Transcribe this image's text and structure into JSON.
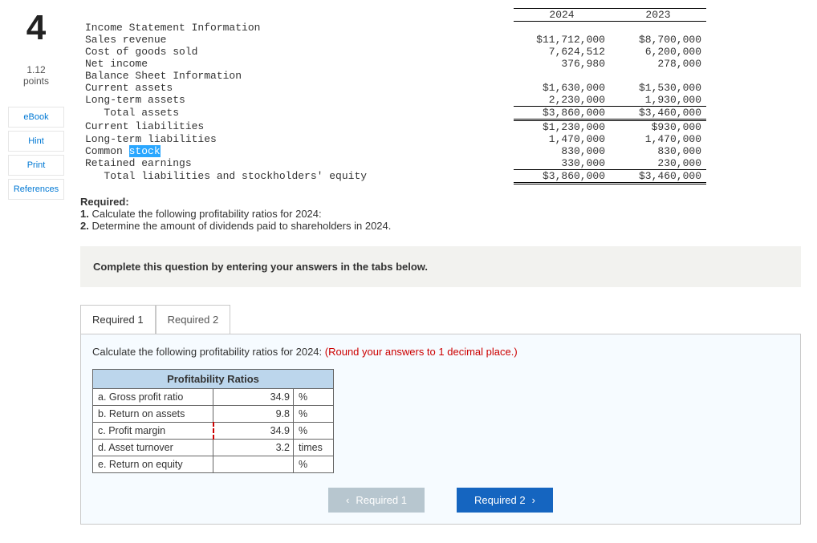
{
  "question_number": "4",
  "points": {
    "value": "1.12",
    "label": "points"
  },
  "side_buttons": [
    "eBook",
    "Hint",
    "Print",
    "References"
  ],
  "fin": {
    "col_years": [
      "2024",
      "2023"
    ],
    "rows": [
      {
        "label": "Income Statement Information",
        "type": "section"
      },
      {
        "label": "Sales revenue",
        "v24": "$11,712,000",
        "v23": "$8,700,000"
      },
      {
        "label": "Cost of goods sold",
        "v24": "7,624,512",
        "v23": "6,200,000"
      },
      {
        "label": "Net income",
        "v24": "376,980",
        "v23": "278,000"
      },
      {
        "label": "Balance Sheet Information",
        "type": "section"
      },
      {
        "label": "Current assets",
        "v24": "$1,630,000",
        "v23": "$1,530,000"
      },
      {
        "label": "Long-term assets",
        "v24": "2,230,000",
        "v23": "1,930,000"
      },
      {
        "label": "   Total assets",
        "v24": "$3,860,000",
        "v23": "$3,460,000",
        "type": "grandtotal"
      },
      {
        "label": "Current liabilities",
        "v24": "$1,230,000",
        "v23": "$930,000"
      },
      {
        "label": "Long-term liabilities",
        "v24": "1,470,000",
        "v23": "1,470,000"
      },
      {
        "label_html": true,
        "label_pre": "Common ",
        "label_hi": "stock",
        "v24": "830,000",
        "v23": "830,000"
      },
      {
        "label": "Retained earnings",
        "v24": "330,000",
        "v23": "230,000"
      },
      {
        "label": "   Total liabilities and stockholders' equity",
        "v24": "$3,860,000",
        "v23": "$3,460,000",
        "type": "grandtotal"
      }
    ]
  },
  "required": {
    "heading": "Required:",
    "items": [
      "Calculate the following profitability ratios for 2024:",
      "Determine the amount of dividends paid to shareholders in 2024."
    ]
  },
  "instruction_bar": "Complete this question by entering your answers in the tabs below.",
  "tabs": [
    {
      "label": "Required 1",
      "active": true
    },
    {
      "label": "Required 2",
      "active": false
    }
  ],
  "tab_prompt": {
    "text": "Calculate the following profitability ratios for 2024: ",
    "note": "(Round your answers to 1 decimal place.)"
  },
  "ratio_table": {
    "header": "Profitability Ratios",
    "rows": [
      {
        "label": "a. Gross profit ratio",
        "value": "34.9",
        "unit": "%",
        "dashed": "none"
      },
      {
        "label": "b. Return on assets",
        "value": "9.8",
        "unit": "%",
        "dashed": "none"
      },
      {
        "label": "c. Profit margin",
        "value": "34.9",
        "unit": "%",
        "dashed": "red"
      },
      {
        "label": "d. Asset turnover",
        "value": "3.2",
        "unit": "times",
        "dashed": "blue"
      },
      {
        "label": "e. Return on equity",
        "value": "",
        "unit": "%",
        "dashed": "none"
      }
    ]
  },
  "nav": {
    "prev": "Required 1",
    "next": "Required 2"
  }
}
